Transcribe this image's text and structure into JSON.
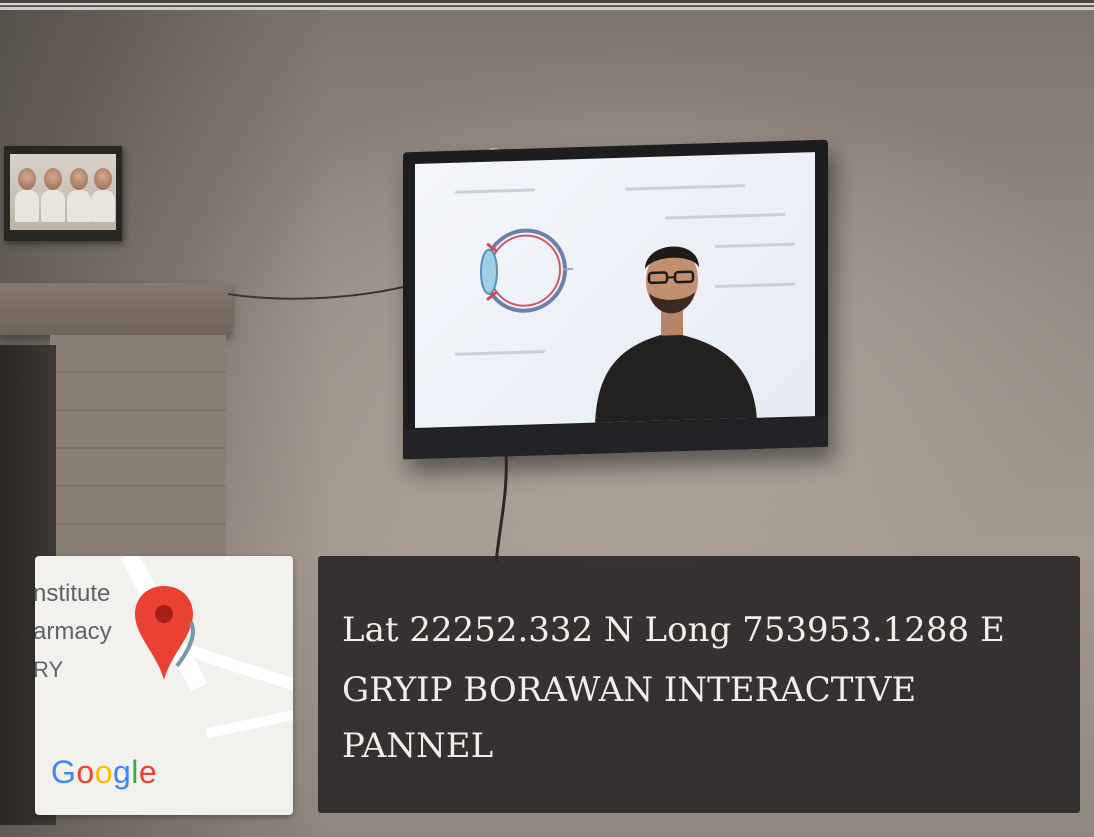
{
  "map": {
    "place_lines": [
      "nstitute",
      "armacy",
      "RY"
    ],
    "logo": [
      "G",
      "o",
      "o",
      "g",
      "l",
      "e"
    ],
    "pin_icon": "map-pin-icon",
    "pin_color": "#E94235"
  },
  "caption": {
    "line1": "Lat 22252.332 N Long 753953.1288 E",
    "line2": "GRYIP BORAWAN INTERACTIVE",
    "line3": "PANNEL"
  }
}
